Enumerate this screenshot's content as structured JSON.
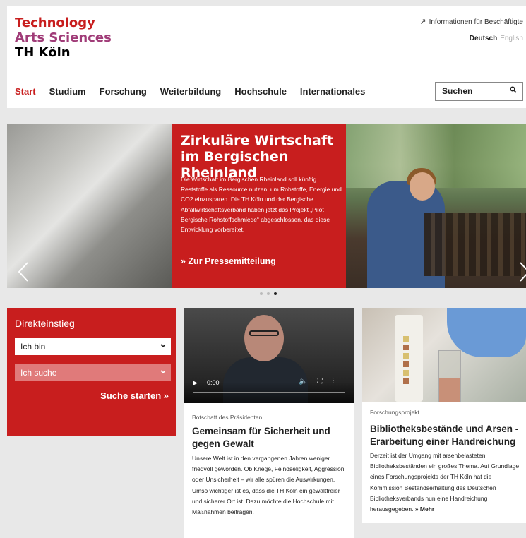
{
  "logo": {
    "line1": "Technology",
    "line2": "Arts Sciences",
    "line3": "TH Köln"
  },
  "header": {
    "employee_link": "Informationen für Beschäftigte",
    "lang_de": "Deutsch",
    "lang_en": "English"
  },
  "nav": {
    "items": [
      {
        "label": "Start",
        "active": true
      },
      {
        "label": "Studium"
      },
      {
        "label": "Forschung"
      },
      {
        "label": "Weiterbildung"
      },
      {
        "label": "Hochschule"
      },
      {
        "label": "Internationales"
      }
    ]
  },
  "search": {
    "label": "Suchen",
    "icon": "search-icon"
  },
  "hero": {
    "title": "Zirkuläre Wirtschaft im Bergischen Rheinland",
    "body": "Die Wirtschaft im Bergischen Rheinland soll künftig Reststoffe als Ressource nutzen, um Rohstoffe, Energie und CO2 einzusparen. Die TH Köln und der Bergische Abfallwirtschaftsverband haben jetzt das Projekt „Pilot Bergische Rohstoffschmiede“ abgeschlossen, das diese Entwicklung vorbereitet.",
    "link": "» Zur Pressemitteilung"
  },
  "direkteinstieg": {
    "title": "Direkteinstieg",
    "select1": "Ich bin",
    "select2": "Ich suche",
    "submit": "Suche starten »"
  },
  "card1": {
    "video_time": "0:00",
    "kicker": "Botschaft des Präsidenten",
    "title": "Gemeinsam für Sicherheit und gegen Gewalt",
    "body": "Unsere Welt ist in den vergangenen Jahren weniger friedvoll geworden. Ob Kriege, Feindseligkeit, Aggression oder Unsicherheit – wir alle spüren die Auswirkungen. Umso wichtiger ist es, dass die TH Köln ein gewaltfreier und sicherer Ort ist. Dazu möchte die Hochschule mit Maßnahmen beitragen."
  },
  "card2": {
    "kicker": "Forschungsprojekt",
    "title": "Bibliotheksbestände und Arsen - Erarbeitung einer Handreichung",
    "body": "Derzeit ist der Umgang mit arsenbelasteten Bibliotheksbeständen ein großes Thema. Auf Grundlage eines Forschungsprojekts der TH Köln hat die Kommission Bestandserhaltung des Deutschen Bibliotheksverbands nun eine Handreichung herausgegeben.",
    "more": "» Mehr"
  },
  "colors": {
    "brand_red": "#c81e1e",
    "brand_purple": "#a03c78"
  }
}
